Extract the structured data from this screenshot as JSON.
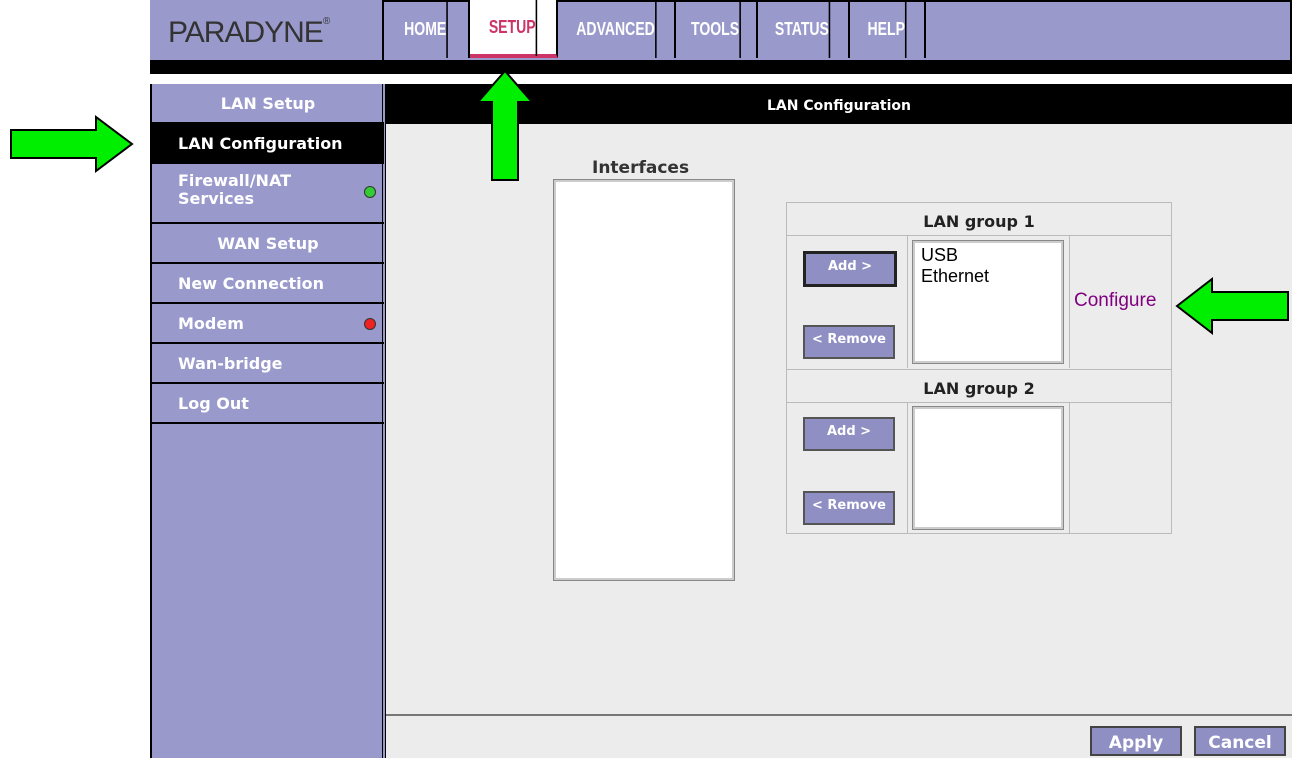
{
  "brand": {
    "logo": "PARADYNE",
    "logo_mark": "®"
  },
  "nav": {
    "tabs": [
      {
        "label": "HOME",
        "active": false
      },
      {
        "label": "SETUP",
        "active": true
      },
      {
        "label": "ADVANCED",
        "active": false
      },
      {
        "label": "TOOLS",
        "active": false
      },
      {
        "label": "STATUS",
        "active": false
      },
      {
        "label": "HELP",
        "active": false
      }
    ]
  },
  "sidebar": {
    "items": [
      {
        "label": "LAN Setup",
        "type": "header"
      },
      {
        "label": "LAN Configuration",
        "type": "link",
        "active": true
      },
      {
        "label": "Firewall/NAT Services",
        "type": "link",
        "status": "green"
      },
      {
        "label": "WAN Setup",
        "type": "header"
      },
      {
        "label": "New Connection",
        "type": "link"
      },
      {
        "label": "Modem",
        "type": "link",
        "status": "red"
      },
      {
        "label": "Wan-bridge",
        "type": "link"
      },
      {
        "label": "Log Out",
        "type": "link"
      }
    ]
  },
  "main": {
    "title": "LAN Configuration",
    "interfaces_label": "Interfaces",
    "group1": {
      "title": "LAN group 1",
      "add_label": "Add >",
      "remove_label": "< Remove",
      "members": [
        "USB",
        "Ethernet"
      ],
      "configure_label": "Configure"
    },
    "group2": {
      "title": "LAN group 2",
      "add_label": "Add >",
      "remove_label": "< Remove",
      "members": []
    }
  },
  "footer": {
    "apply_label": "Apply",
    "cancel_label": "Cancel"
  },
  "colors": {
    "nav_bg": "#9999cc",
    "active_tab": "#cc3366",
    "content_bg": "#ececec",
    "status_green": "#33cc33",
    "status_red": "#ee2222",
    "annotation_arrow": "#00ee00",
    "link": "#800080"
  }
}
